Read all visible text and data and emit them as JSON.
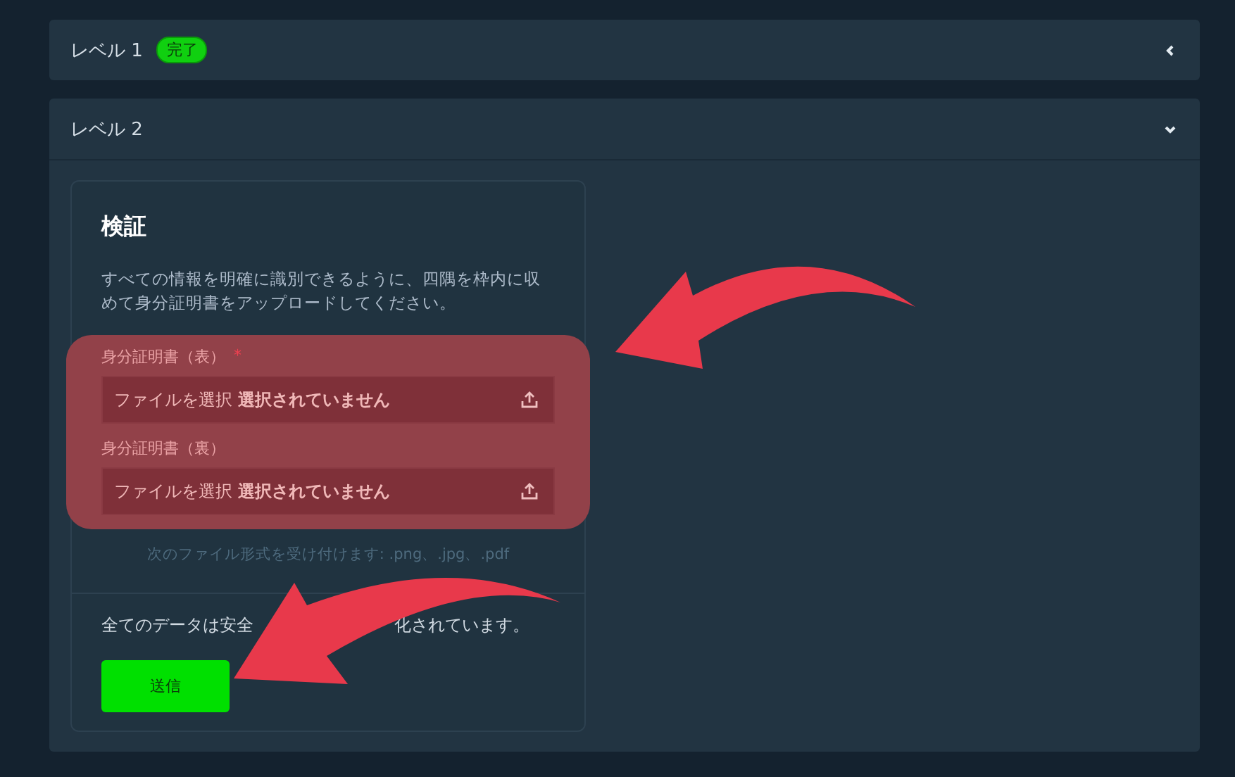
{
  "sections": [
    {
      "title": "レベル 1",
      "badge": "完了",
      "expanded": false
    },
    {
      "title": "レベル 2",
      "expanded": true,
      "card": {
        "title": "検証",
        "description": "すべての情報を明確に識別できるように、四隅を枠内に収めて身分証明書をアップロードしてください。",
        "fields": [
          {
            "label": "身分証明書（表）",
            "required": true,
            "required_mark": "*",
            "button": "ファイルを選択",
            "status": "選択されていません"
          },
          {
            "label": "身分証明書（裏）",
            "required": false,
            "button": "ファイルを選択",
            "status": "選択されていません"
          }
        ],
        "hint": "次のファイル形式を受け付けます: .png、.jpg、.pdf",
        "footer_text": [
          "全てのデータは安全",
          "化されています。"
        ],
        "submit": "送信"
      }
    }
  ]
}
